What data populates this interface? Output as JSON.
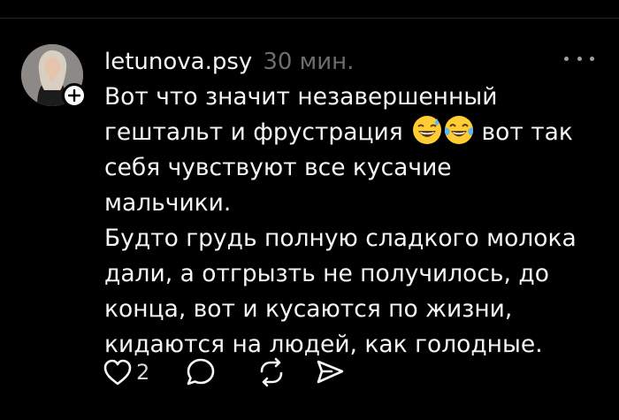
{
  "post": {
    "username": "letunova.psy",
    "time": "30 мин.",
    "lines": [
      "Вот что значит незавершенный",
      "гештальт и фрустрация",
      "вот так",
      "себя чувствуют все кусачие мальчики.",
      "Будто грудь полную сладкого молока",
      "дали, а отгрызть не получилось, до",
      "конца, вот и кусаются по жизни,",
      "кидаются на людей, как голодные."
    ],
    "emojis": [
      "grinning-sweat-emoji",
      "tears-of-joy-emoji"
    ]
  },
  "actions": {
    "like_count": "2",
    "icons": [
      "heart-icon",
      "comment-icon",
      "repost-icon",
      "share-icon"
    ]
  },
  "colors": {
    "background": "#000000",
    "text": "#f3f5f7",
    "secondary": "#6d6d6d"
  }
}
